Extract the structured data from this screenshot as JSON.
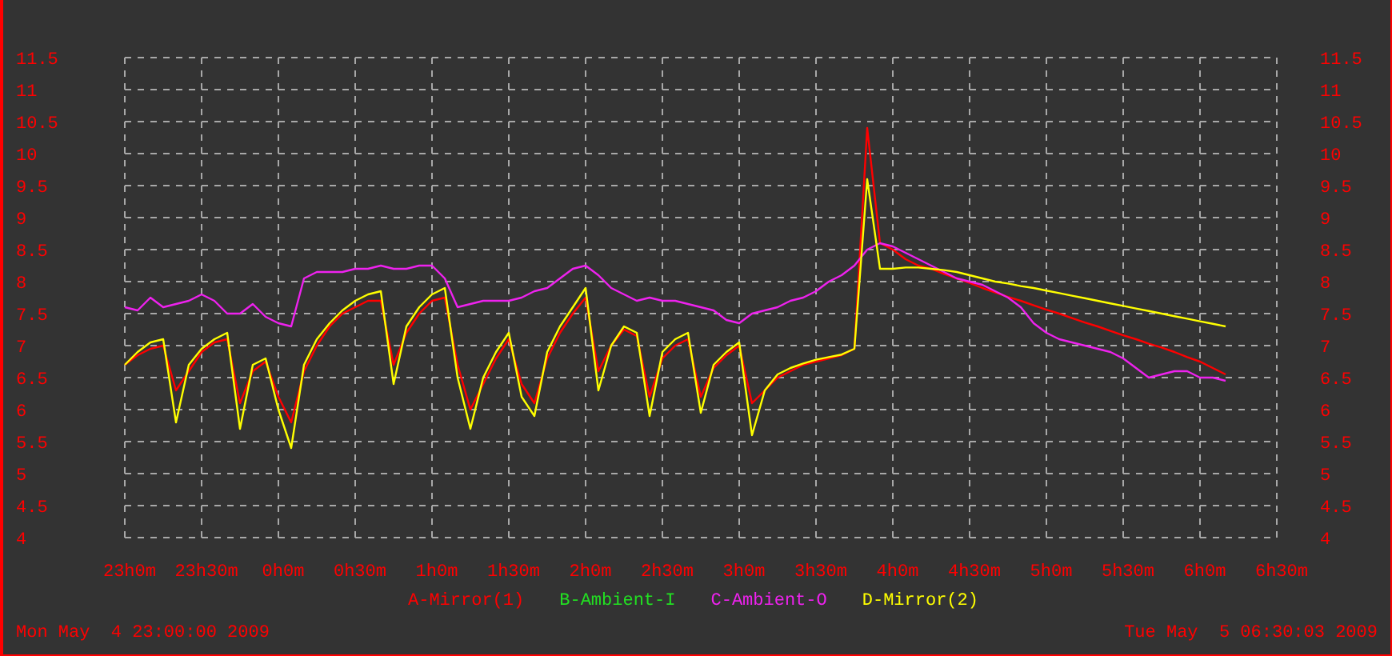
{
  "chart_data": {
    "type": "line",
    "grid": true,
    "ylim": [
      4,
      11.5
    ],
    "y2lim": [
      4,
      11.5
    ],
    "yticks": [
      4,
      4.5,
      5,
      5.5,
      6,
      6.5,
      7,
      7.5,
      8,
      8.5,
      9,
      9.5,
      10,
      10.5,
      11,
      11.5
    ],
    "y2ticks": [
      4,
      4.5,
      5,
      5.5,
      6,
      6.5,
      7,
      7.5,
      8,
      8.5,
      9,
      9.5,
      10,
      10.5,
      11,
      11.5
    ],
    "categories": [
      "23h0m",
      null,
      null,
      null,
      null,
      null,
      "23h30m",
      null,
      null,
      null,
      null,
      null,
      "0h0m",
      null,
      null,
      null,
      null,
      null,
      "0h30m",
      null,
      null,
      null,
      null,
      null,
      "1h0m",
      null,
      null,
      null,
      null,
      null,
      "1h30m",
      null,
      null,
      null,
      null,
      null,
      "2h0m",
      null,
      null,
      null,
      null,
      null,
      "2h30m",
      null,
      null,
      null,
      null,
      null,
      "3h0m",
      null,
      null,
      null,
      null,
      null,
      "3h30m",
      null,
      null,
      null,
      null,
      null,
      "4h0m",
      null,
      null,
      null,
      null,
      null,
      "4h30m",
      null,
      null,
      null,
      null,
      null,
      "5h0m",
      null,
      null,
      null,
      null,
      null,
      "5h30m",
      null,
      null,
      null,
      null,
      null,
      "6h0m",
      null,
      null,
      null,
      null,
      null,
      "6h30m"
    ],
    "series": [
      {
        "name": "A-Mirror(1)",
        "color": "#ff0000",
        "values": [
          6.7,
          6.85,
          6.95,
          7.0,
          6.3,
          6.6,
          6.9,
          7.05,
          7.1,
          6.1,
          6.6,
          6.75,
          6.2,
          5.8,
          6.6,
          7.0,
          7.3,
          7.5,
          7.6,
          7.7,
          7.7,
          6.7,
          7.2,
          7.5,
          7.7,
          7.75,
          6.7,
          6.0,
          6.4,
          6.8,
          7.1,
          6.4,
          6.1,
          6.8,
          7.2,
          7.5,
          7.75,
          6.6,
          7.0,
          7.25,
          7.15,
          6.2,
          6.8,
          7.0,
          7.1,
          6.2,
          6.65,
          6.85,
          7.0,
          6.1,
          6.3,
          6.5,
          6.6,
          6.7,
          6.75,
          6.8,
          6.85,
          6.95,
          10.4,
          8.6,
          8.5,
          8.35,
          8.25,
          8.2,
          8.12,
          8.05,
          7.98,
          7.9,
          7.83,
          7.76,
          7.7,
          7.63,
          7.56,
          7.5,
          7.43,
          7.36,
          7.3,
          7.23,
          7.16,
          7.1,
          7.03,
          6.97,
          6.9,
          6.82,
          6.75,
          6.65,
          6.55,
          null,
          null,
          null,
          null
        ]
      },
      {
        "name": "B-Ambient-I",
        "color": "#22e022",
        "values": [
          null,
          null,
          null,
          null,
          null,
          null,
          null,
          null,
          null,
          null,
          null,
          null,
          null,
          null,
          null,
          null,
          null,
          null,
          null,
          null,
          null,
          null,
          null,
          null,
          null,
          null,
          null,
          null,
          null,
          null,
          null,
          null,
          null,
          null,
          null,
          null,
          null,
          null,
          null,
          null,
          null,
          null,
          null,
          null,
          null,
          null,
          null,
          null,
          null,
          null,
          null,
          null,
          null,
          null,
          null,
          null,
          null,
          null,
          null,
          null,
          null,
          null,
          null,
          null,
          null,
          null,
          null,
          null,
          null,
          null,
          null,
          null,
          null,
          null,
          null,
          null,
          null,
          null,
          null,
          null,
          null,
          null,
          null,
          null,
          null,
          null,
          null,
          null,
          null,
          null,
          null
        ]
      },
      {
        "name": "C-Ambient-O",
        "color": "#ee22ee",
        "values": [
          7.6,
          7.55,
          7.75,
          7.6,
          7.65,
          7.7,
          7.8,
          7.7,
          7.5,
          7.5,
          7.65,
          7.45,
          7.35,
          7.3,
          8.05,
          8.15,
          8.15,
          8.15,
          8.2,
          8.2,
          8.25,
          8.2,
          8.2,
          8.25,
          8.25,
          8.05,
          7.6,
          7.65,
          7.7,
          7.7,
          7.7,
          7.75,
          7.85,
          7.9,
          8.05,
          8.2,
          8.25,
          8.1,
          7.9,
          7.8,
          7.7,
          7.75,
          7.7,
          7.7,
          7.65,
          7.6,
          7.55,
          7.4,
          7.35,
          7.5,
          7.55,
          7.6,
          7.7,
          7.75,
          7.85,
          8.0,
          8.1,
          8.25,
          8.5,
          8.6,
          8.55,
          8.45,
          8.35,
          8.25,
          8.15,
          8.05,
          8.0,
          7.95,
          7.85,
          7.75,
          7.6,
          7.35,
          7.2,
          7.1,
          7.05,
          7.0,
          6.95,
          6.9,
          6.8,
          6.65,
          6.5,
          6.55,
          6.6,
          6.6,
          6.5,
          6.5,
          6.45,
          null,
          null,
          null,
          null
        ]
      },
      {
        "name": "D-Mirror(2)",
        "color": "#ffff00",
        "values": [
          6.7,
          6.9,
          7.05,
          7.1,
          5.8,
          6.7,
          6.95,
          7.1,
          7.2,
          5.7,
          6.7,
          6.8,
          6.0,
          5.4,
          6.7,
          7.1,
          7.35,
          7.55,
          7.7,
          7.8,
          7.85,
          6.4,
          7.3,
          7.6,
          7.8,
          7.9,
          6.5,
          5.7,
          6.5,
          6.9,
          7.2,
          6.2,
          5.9,
          6.9,
          7.3,
          7.6,
          7.9,
          6.3,
          7.0,
          7.3,
          7.2,
          5.9,
          6.9,
          7.1,
          7.2,
          5.95,
          6.7,
          6.9,
          7.05,
          5.6,
          6.3,
          6.55,
          6.65,
          6.72,
          6.78,
          6.82,
          6.86,
          6.95,
          9.6,
          8.2,
          8.2,
          8.22,
          8.22,
          8.2,
          8.18,
          8.15,
          8.1,
          8.05,
          8.0,
          7.97,
          7.93,
          7.9,
          7.86,
          7.82,
          7.78,
          7.74,
          7.7,
          7.66,
          7.62,
          7.58,
          7.54,
          7.5,
          7.46,
          7.42,
          7.38,
          7.34,
          7.3,
          null,
          null,
          null,
          null
        ]
      }
    ]
  },
  "start_time": "Mon May  4 23:00:00 2009",
  "end_time": "Tue May  5 06:30:03 2009"
}
